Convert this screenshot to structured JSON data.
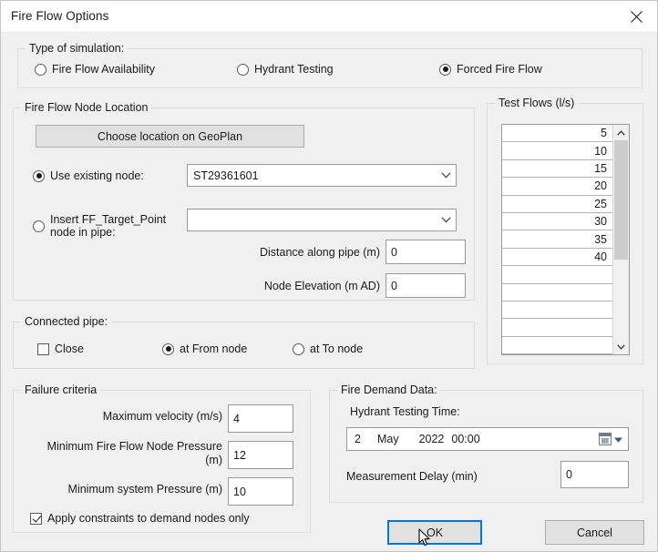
{
  "window": {
    "title": "Fire Flow Options",
    "close_icon": "close-icon"
  },
  "simulation_type": {
    "legend": "Type of simulation:",
    "options": [
      {
        "label": "Fire Flow Availability",
        "selected": false
      },
      {
        "label": "Hydrant Testing",
        "selected": false
      },
      {
        "label": "Forced Fire Flow",
        "selected": true
      }
    ]
  },
  "node_location": {
    "legend": "Fire Flow Node Location",
    "choose_button": "Choose location on GeoPlan",
    "use_existing_label": "Use existing node:",
    "use_existing_selected": true,
    "existing_node_value": "ST29361601",
    "insert_label": "Insert FF_Target_Point node in pipe:",
    "insert_selected": false,
    "insert_pipe_value": "",
    "distance_label": "Distance along pipe (m)",
    "distance_value": "0",
    "elevation_label": "Node Elevation (m AD)",
    "elevation_value": "0"
  },
  "test_flows": {
    "legend": "Test Flows (l/s)",
    "values": [
      "5",
      "10",
      "15",
      "20",
      "25",
      "30",
      "35",
      "40",
      "",
      "",
      "",
      "",
      ""
    ],
    "scroll_up_icon": "chevron-up-icon",
    "scroll_down_icon": "chevron-down-icon"
  },
  "connected_pipe": {
    "legend": "Connected pipe:",
    "close_label": "Close",
    "close_checked": false,
    "at_from_label": "at From node",
    "at_from_selected": true,
    "at_to_label": "at To node",
    "at_to_selected": false
  },
  "failure_criteria": {
    "legend": "Failure criteria",
    "max_velocity_label": "Maximum velocity (m/s)",
    "max_velocity_value": "4",
    "min_ff_node_pressure_label": "Minimum Fire Flow Node Pressure (m)",
    "min_ff_node_pressure_value": "12",
    "min_system_pressure_label": "Minimum system Pressure (m)",
    "min_system_pressure_value": "10",
    "apply_constraints_label": "Apply constraints to demand nodes only",
    "apply_constraints_checked": true
  },
  "fire_demand": {
    "legend": "Fire Demand Data:",
    "hydrant_time_label": "Hydrant Testing Time:",
    "date_day": "2",
    "date_month": "May",
    "date_year": "2022",
    "date_time": "00:00",
    "calendar_icon": "calendar-icon",
    "dropdown_icon": "chevron-down-icon",
    "delay_label": "Measurement Delay (min)",
    "delay_value": "0"
  },
  "footer": {
    "ok_label": "OK",
    "cancel_label": "Cancel"
  },
  "colors": {
    "dialog_bg": "#f0f0f0",
    "titlebar_bg": "#ffffff",
    "focus_accent": "#0078d7",
    "button_face": "#e1e1e1",
    "field_bg": "#ffffff"
  }
}
